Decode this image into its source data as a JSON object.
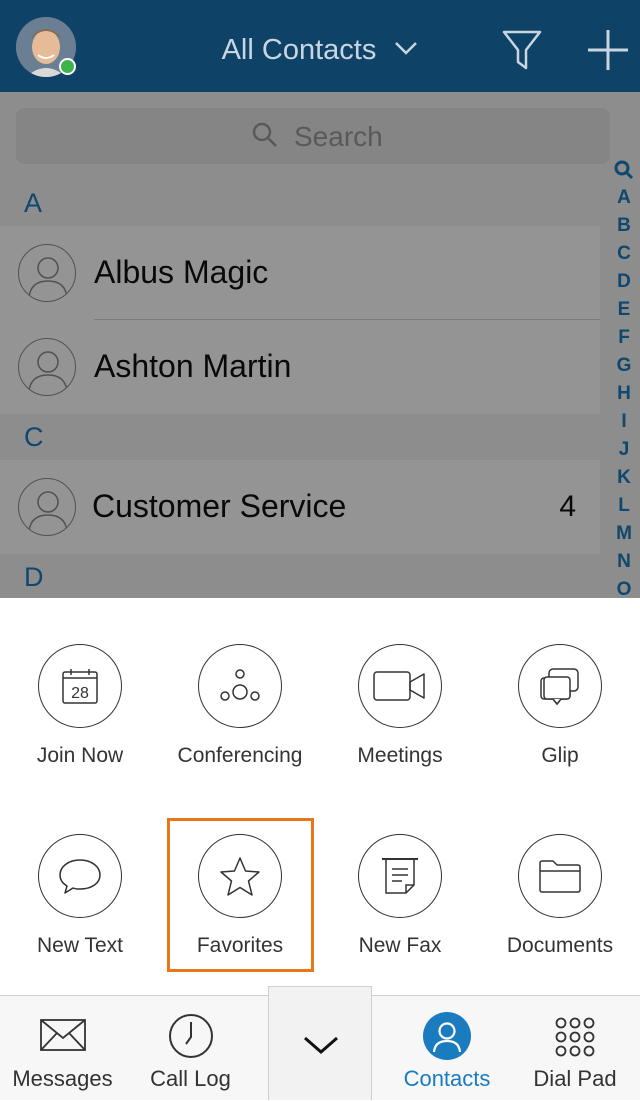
{
  "header": {
    "title": "All Contacts",
    "icons": {
      "title_caret": "chevron-down-icon",
      "filter": "filter-icon",
      "add": "plus-icon"
    },
    "presence_color": "#3cb44b"
  },
  "search": {
    "placeholder": "Search"
  },
  "contacts": {
    "sections": [
      {
        "letter": "A",
        "items": [
          {
            "name": "Albus Magic",
            "count": ""
          },
          {
            "name": "Ashton Martin",
            "count": ""
          }
        ]
      },
      {
        "letter": "C",
        "items": [
          {
            "name": "Customer Service",
            "count": "4"
          }
        ]
      },
      {
        "letter": "D",
        "items": []
      }
    ]
  },
  "alpha_index": [
    "Q",
    "A",
    "B",
    "C",
    "D",
    "E",
    "F",
    "G",
    "H",
    "I",
    "J",
    "K",
    "L",
    "M",
    "N",
    "O"
  ],
  "actions": [
    {
      "label": "Join Now",
      "icon": "calendar-icon",
      "calendar_day": "28"
    },
    {
      "label": "Conferencing",
      "icon": "conference-icon"
    },
    {
      "label": "Meetings",
      "icon": "video-camera-icon"
    },
    {
      "label": "Glip",
      "icon": "chat-bubbles-icon"
    },
    {
      "label": "New Text",
      "icon": "speech-bubble-icon"
    },
    {
      "label": "Favorites",
      "icon": "star-icon",
      "highlighted": true
    },
    {
      "label": "New Fax",
      "icon": "fax-icon"
    },
    {
      "label": "Documents",
      "icon": "folder-icon"
    }
  ],
  "tabbar": {
    "tabs": [
      {
        "label": "Messages",
        "icon": "envelope-icon"
      },
      {
        "label": "Call Log",
        "icon": "clock-icon"
      },
      {
        "label": "",
        "icon": "chevron-down-icon"
      },
      {
        "label": "Contacts",
        "icon": "person-icon",
        "active": true
      },
      {
        "label": "Dial Pad",
        "icon": "dialpad-icon"
      }
    ]
  },
  "colors": {
    "header_bg": "#0e4266",
    "accent": "#1a7bbf",
    "highlight": "#e8761b"
  }
}
